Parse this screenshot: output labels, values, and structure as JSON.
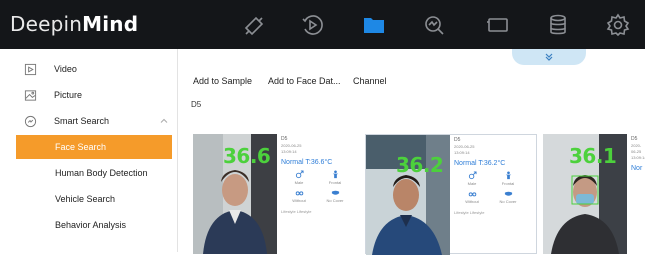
{
  "app": {
    "brand_regular": "Deepin",
    "brand_bold": "Mind"
  },
  "topnav": {
    "icons": [
      "camera-icon",
      "playback-icon",
      "folder-icon",
      "search-analytics-icon",
      "display-icon",
      "database-icon",
      "settings-icon"
    ],
    "active": "folder-icon",
    "accent": "#1e88e5"
  },
  "sidebar": {
    "items": [
      {
        "label": "Video",
        "icon": "video-file-icon"
      },
      {
        "label": "Picture",
        "icon": "picture-icon"
      },
      {
        "label": "Smart Search",
        "icon": "smart-search-icon"
      },
      {
        "label": "Face Search",
        "active": true
      },
      {
        "label": "Human Body Detection"
      },
      {
        "label": "Vehicle Search"
      },
      {
        "label": "Behavior Analysis"
      }
    ],
    "active_color": "#f59b2a"
  },
  "toolbar": {
    "add_to_sample": "Add to Sample",
    "add_to_face_db": "Add to Face Dat...",
    "channel": "Channel"
  },
  "breadcrumb": "D5",
  "results": [
    {
      "temp_overlay": "36.6",
      "channel": "D5",
      "date": "2020-06-25",
      "time": "13:09:14",
      "status": "Normal T:36.6°C",
      "attrs": [
        "Male",
        "Frontal",
        "Without",
        "No Cover"
      ],
      "footer": "Lifestyle  Lifestyle"
    },
    {
      "temp_overlay": "36.2",
      "channel": "D5",
      "date": "2020-06-25",
      "time": "13:09:14",
      "status": "Normal T:36.2°C",
      "attrs": [
        "Male",
        "Frontal",
        "Without",
        "No Cover"
      ],
      "footer": "Lifestyle  Lifestyle",
      "selected": true
    },
    {
      "temp_overlay": "36.1",
      "channel": "D5",
      "date": "2020-06-25",
      "time": "13:09:14",
      "status": "Nor",
      "attrs": [],
      "footer": ""
    }
  ]
}
